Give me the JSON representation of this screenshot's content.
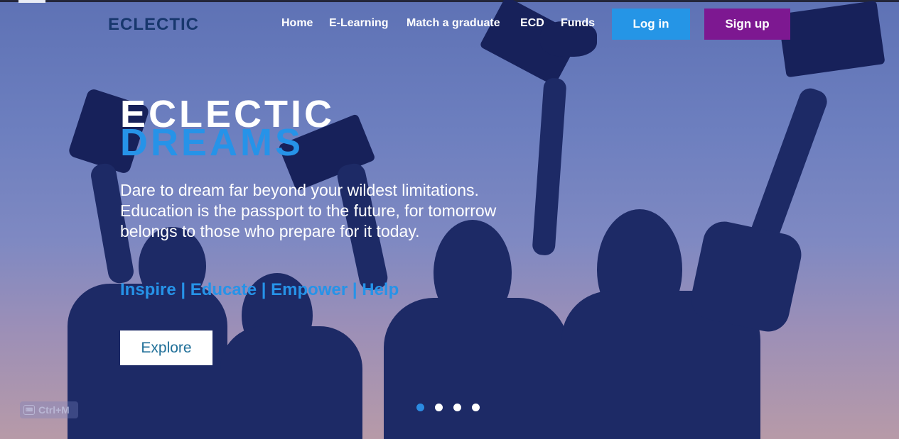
{
  "brand": {
    "logo": "ECLECTIC"
  },
  "nav": {
    "links": [
      "Home",
      "E-Learning",
      "Match a graduate",
      "ECD",
      "Funds"
    ],
    "login_label": "Log in",
    "signup_label": "Sign up"
  },
  "hero": {
    "title_line1": "ECLECTIC",
    "title_line2": "DREAMS",
    "description_line1": "Dare to dream far beyond your wildest limitations.",
    "description_line2": "Education is the passport to the future, for tomorrow",
    "description_line3": "belongs to those who prepare for it today.",
    "tagline": "Inspire | Educate | Empower | Help",
    "explore_label": "Explore"
  },
  "carousel": {
    "slides": 4,
    "active_index": 0
  },
  "overlay": {
    "shortcut": "Ctrl+M"
  },
  "colors": {
    "accent_blue": "#2693e8",
    "signup_purple": "#7d1891",
    "login_blue": "#2595e6",
    "logo_navy": "#17376d"
  }
}
